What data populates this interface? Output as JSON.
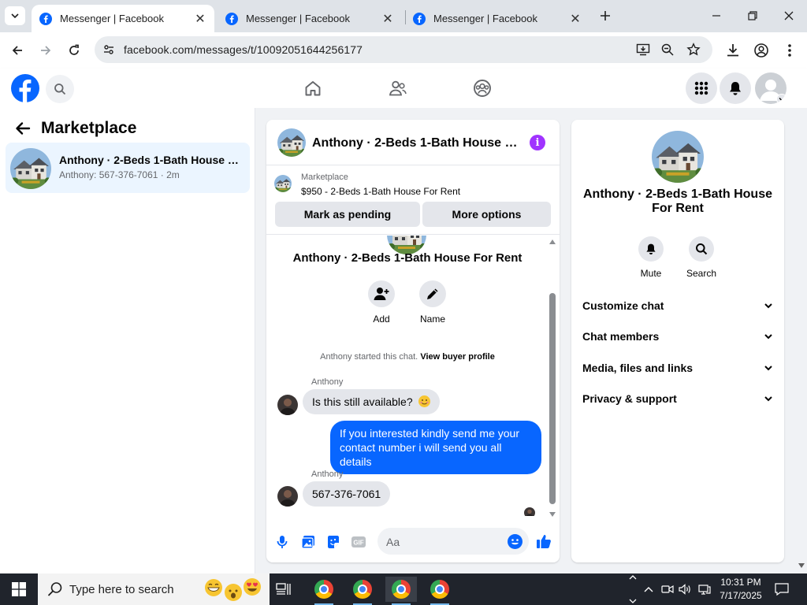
{
  "browser": {
    "tabs": [
      {
        "title": "Messenger | Facebook",
        "active": true
      },
      {
        "title": "Messenger | Facebook",
        "active": false
      },
      {
        "title": "Messenger | Facebook",
        "active": false
      }
    ],
    "url": "facebook.com/messages/t/10092051644256177"
  },
  "left": {
    "heading": "Marketplace",
    "conversation": {
      "name": "Anthony · 2-Beds 1-Bath House For Rent",
      "preview": "Anthony: 567-376-7061 · 2m"
    }
  },
  "chat": {
    "title": "Anthony · 2-Beds 1-Bath House For Rent",
    "marketplace": {
      "label": "Marketplace",
      "listing": "$950 - 2-Beds 1-Bath House For Rent",
      "mark_pending": "Mark as pending",
      "more_options": "More options"
    },
    "conversation_title": "Anthony · 2-Beds 1-Bath House For Rent",
    "actions": {
      "add": "Add",
      "name": "Name"
    },
    "started_text": "Anthony started this chat.",
    "view_profile": "View buyer profile",
    "messages": [
      {
        "sender": "Anthony",
        "text": "Is this still available?",
        "direction": "in"
      },
      {
        "sender": "",
        "text": "If you interested kindly send me your contact number i will send you all details",
        "direction": "out"
      },
      {
        "sender": "Anthony",
        "text": "567-376-7061",
        "direction": "in"
      }
    ],
    "composer_placeholder": "Aa"
  },
  "details": {
    "name": "Anthony · 2-Beds 1-Bath House For Rent",
    "mute": "Mute",
    "search": "Search",
    "sections": [
      "Customize chat",
      "Chat members",
      "Media, files and links",
      "Privacy & support"
    ]
  },
  "taskbar": {
    "search_placeholder": "Type here to search",
    "time": "10:31 PM",
    "date": "7/17/2025"
  },
  "colors": {
    "facebook_blue": "#0866ff",
    "info_purple": "#a033ff",
    "selected_row": "#ebf5ff"
  }
}
